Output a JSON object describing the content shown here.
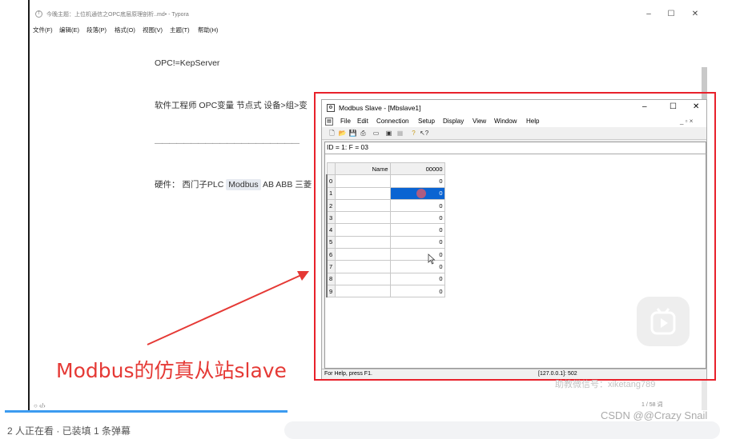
{
  "typora": {
    "window_title": "今晚主题：上位机通信之OPC底层原理剖析..md• - Typora",
    "menu": [
      {
        "label": "文件(F)"
      },
      {
        "label": "编辑(E)"
      },
      {
        "label": "段落(P)"
      },
      {
        "label": "格式(O)"
      },
      {
        "label": "视图(V)"
      },
      {
        "label": "主题(T)"
      },
      {
        "label": "帮助(H)"
      }
    ],
    "line1": "OPC!=KepServer",
    "line2": "软件工程师   OPC变量  节点式   设备>组>变",
    "dashes": "————————————————————",
    "line3_prefix": "硬件：  西门子PLC  ",
    "line3_highlight": "Modbus",
    "line3_suffix": " AB  ABB  三菱",
    "status_left": "○   ‹/›",
    "word_count": "1 / 58 词",
    "wechat_watermark": "助教微信号：xiketang789"
  },
  "modbus": {
    "title": "Modbus Slave - [Mbslave1]",
    "menu": [
      {
        "label": "File"
      },
      {
        "label": "Edit"
      },
      {
        "label": "Connection"
      },
      {
        "label": "Setup"
      },
      {
        "label": "Display"
      },
      {
        "label": "View"
      },
      {
        "label": "Window"
      },
      {
        "label": "Help"
      }
    ],
    "child_controls": "_ ▫ ×",
    "id_line": "ID = 1: F = 03",
    "name_header": "Name",
    "column_header": "00000",
    "rows": [
      {
        "num": "0",
        "value": "0"
      },
      {
        "num": "1",
        "value": "0"
      },
      {
        "num": "2",
        "value": "0"
      },
      {
        "num": "3",
        "value": "0"
      },
      {
        "num": "4",
        "value": "0"
      },
      {
        "num": "5",
        "value": "0"
      },
      {
        "num": "6",
        "value": "0"
      },
      {
        "num": "7",
        "value": "0"
      },
      {
        "num": "8",
        "value": "0"
      },
      {
        "num": "9",
        "value": "0"
      }
    ],
    "status_help": "For Help, press F1.",
    "status_conn": "[127.0.0.1]: 502"
  },
  "annotation": "Modbus的仿真从站slave",
  "page_footer": {
    "bottom_text": "2 人正在看 · 已装填 1 条弹幕",
    "csdn_mark": "CSDN @@Crazy Snail"
  },
  "colors": {
    "red_highlight": "#e8212b",
    "annotation_red": "#e53935",
    "selected_cell": "#0a64d2",
    "progress_blue": "#3c9bf0"
  }
}
